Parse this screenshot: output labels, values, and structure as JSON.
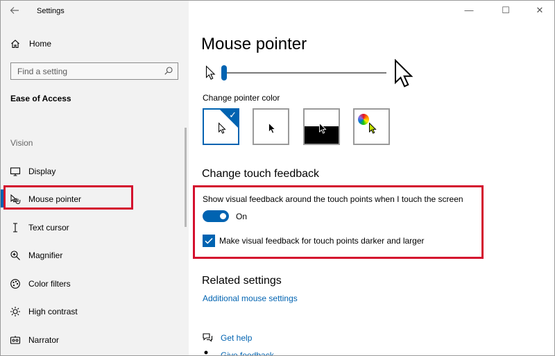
{
  "window": {
    "app_title": "Settings",
    "back_icon": "back-arrow-icon",
    "controls": {
      "minimize": "—",
      "maximize": "☐",
      "close": "✕"
    }
  },
  "sidebar": {
    "home_label": "Home",
    "search_placeholder": "Find a setting",
    "section_title": "Ease of Access",
    "group_label": "Vision",
    "items": [
      {
        "label": "Display",
        "icon": "display-icon"
      },
      {
        "label": "Mouse pointer",
        "icon": "mouse-pointer-icon",
        "active": true
      },
      {
        "label": "Text cursor",
        "icon": "text-cursor-icon"
      },
      {
        "label": "Magnifier",
        "icon": "magnifier-icon"
      },
      {
        "label": "Color filters",
        "icon": "color-filters-icon"
      },
      {
        "label": "High contrast",
        "icon": "high-contrast-icon"
      },
      {
        "label": "Narrator",
        "icon": "narrator-icon"
      }
    ]
  },
  "main": {
    "page_title": "Mouse pointer",
    "pointer_size_level": 0.0,
    "change_color_label": "Change pointer color",
    "color_options": [
      {
        "name": "white",
        "selected": true
      },
      {
        "name": "black",
        "selected": false
      },
      {
        "name": "inverted",
        "selected": false
      },
      {
        "name": "custom",
        "selected": false
      }
    ],
    "touch_title": "Change touch feedback",
    "feedback_label": "Show visual feedback around the touch points when I touch the screen",
    "toggle_state": "On",
    "darker_label": "Make visual feedback for touch points darker and larger",
    "darker_checked": true,
    "related_title": "Related settings",
    "related_link": "Additional mouse settings",
    "help_link": "Get help",
    "feedback_link": "Give feedback"
  },
  "colors": {
    "accent": "#0063b1",
    "highlight": "#d4102e"
  }
}
